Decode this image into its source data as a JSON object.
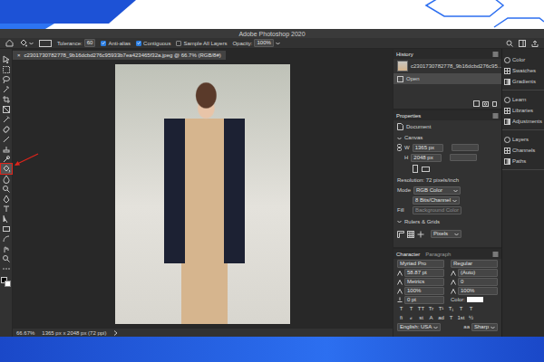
{
  "window": {
    "title": "Adobe Photoshop 2020"
  },
  "options_bar": {
    "tolerance_label": "Tolerance:",
    "tolerance": "60",
    "anti_alias": {
      "label": "Anti-alias",
      "checked": true
    },
    "contiguous": {
      "label": "Contiguous",
      "checked": true
    },
    "sample_all_layers": {
      "label": "Sample All Layers",
      "checked": false
    },
    "opacity_label": "Opacity:",
    "opacity": "100%"
  },
  "document_tab": {
    "label": "c2301730782778_9b16dcbd276c95933b7ea423465f32a.jpeg @ 66.7% (RGB/8#)",
    "close": "×"
  },
  "toolbar": {
    "tools": [
      {
        "selected": false
      },
      {
        "selected": false
      },
      {
        "selected": false
      },
      {
        "selected": false
      },
      {
        "selected": false
      },
      {
        "selected": false
      },
      {
        "selected": false
      },
      {
        "selected": false
      },
      {
        "selected": false
      },
      {
        "selected": false
      },
      {
        "selected": false
      },
      {
        "selected": true
      },
      {
        "selected": false
      },
      {
        "selected": false
      },
      {
        "selected": false
      },
      {
        "selected": false
      },
      {
        "selected": false
      },
      {
        "selected": false
      },
      {
        "selected": false
      },
      {
        "selected": false
      },
      {
        "selected": false
      },
      {
        "selected": false
      }
    ]
  },
  "status_bar": {
    "zoom": "66.67%",
    "info": "1365 px x 2048 px (72 ppi)"
  },
  "history": {
    "title": "History",
    "snapshot": "c2301730782778_9b16dcbd276c95...",
    "items": [
      {
        "label": "Open",
        "selected": true
      }
    ]
  },
  "properties": {
    "title": "Properties",
    "kind_label": "Document",
    "canvas_title": "Canvas",
    "width_label": "W",
    "width": "1365 px",
    "height_label": "H",
    "height": "2048 px",
    "resolution": "Resolution: 72 pixels/inch",
    "mode_label": "Mode",
    "mode": "RGB Color",
    "depth": "8 Bits/Channel",
    "fill_label": "Fill",
    "fill": "Background Color",
    "fill_disabled": true,
    "rulers_title": "Rulers & Grids",
    "units": "Pixels"
  },
  "character": {
    "tabs": [
      {
        "label": "Character",
        "selected": true
      },
      {
        "label": "Paragraph",
        "selected": false
      }
    ],
    "font": "Myriad Pro",
    "style": "Regular",
    "size": "58.87 pt",
    "leading": "(Auto)",
    "kerning": "Metrics",
    "tracking": "0",
    "vscale": "100%",
    "hscale": "100%",
    "baseline": "0 pt",
    "color_label": "Color:",
    "styles": [
      "T",
      "T",
      "TT",
      "Tr",
      "T¹",
      "T₁",
      "T",
      "T"
    ],
    "opentype": [
      "fi",
      "ℴ",
      "st",
      "A",
      "ad",
      "T",
      "1st",
      "½"
    ],
    "language": "English: USA",
    "aa": "aa",
    "antialias": "Sharp"
  },
  "dock": {
    "groups": [
      [
        {
          "label": "Color"
        },
        {
          "label": "Swatches"
        },
        {
          "label": "Gradients"
        }
      ],
      [
        {
          "label": "Learn"
        },
        {
          "label": "Libraries"
        },
        {
          "label": "Adjustments"
        }
      ],
      [
        {
          "label": "Layers"
        },
        {
          "label": "Channels"
        },
        {
          "label": "Paths"
        }
      ]
    ]
  }
}
